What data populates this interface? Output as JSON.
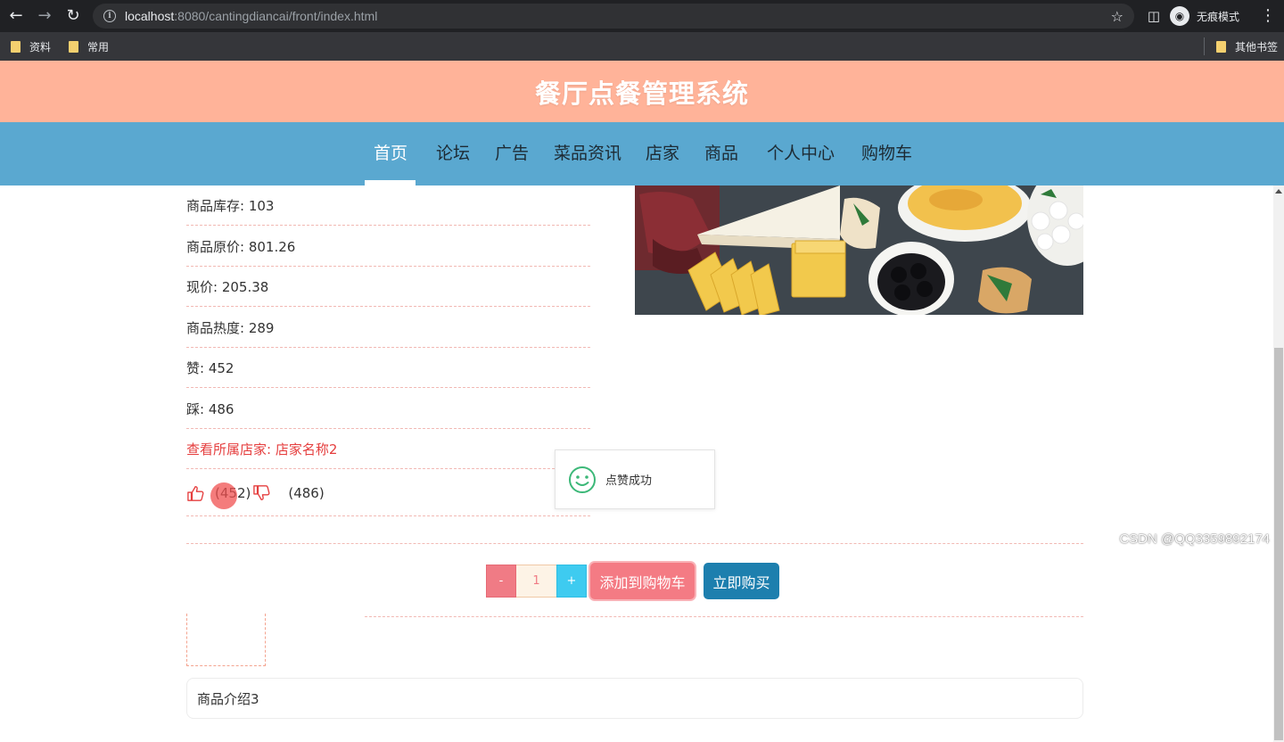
{
  "browser": {
    "url_host": "localhost",
    "url_rest": ":8080/cantingdiancai/front/index.html",
    "profile_label": "无痕模式",
    "bookmarks": [
      "资料",
      "常用"
    ],
    "other_bookmarks": "其他书签"
  },
  "site": {
    "title": "餐厅点餐管理系统",
    "nav": [
      "首页",
      "论坛",
      "广告",
      "菜品资讯",
      "店家",
      "商品",
      "个人中心",
      "购物车"
    ],
    "active_nav": "首页"
  },
  "product": {
    "details": [
      "商品库存: 103",
      "商品原价: 801.26",
      "现价: 205.38",
      "商品热度: 289",
      "赞: 452",
      "踩: 486"
    ],
    "store_link": "查看所属店家: 店家名称2",
    "like_count": "(452)",
    "dislike_count": "(486)",
    "quantity": "1",
    "minus_label": "-",
    "plus_label": "+",
    "add_to_cart": "添加到购物车",
    "buy_now": "立即购买",
    "intro": "商品介绍3"
  },
  "toast": {
    "message": "点赞成功"
  },
  "watermark": "CSDN @QQ3359892174",
  "colors": {
    "header_bg": "#ffb399",
    "nav_bg": "#5aa8d0",
    "store_link": "#e53e3e",
    "cart_button": "#f47b84",
    "buy_button": "#1d7fae"
  }
}
